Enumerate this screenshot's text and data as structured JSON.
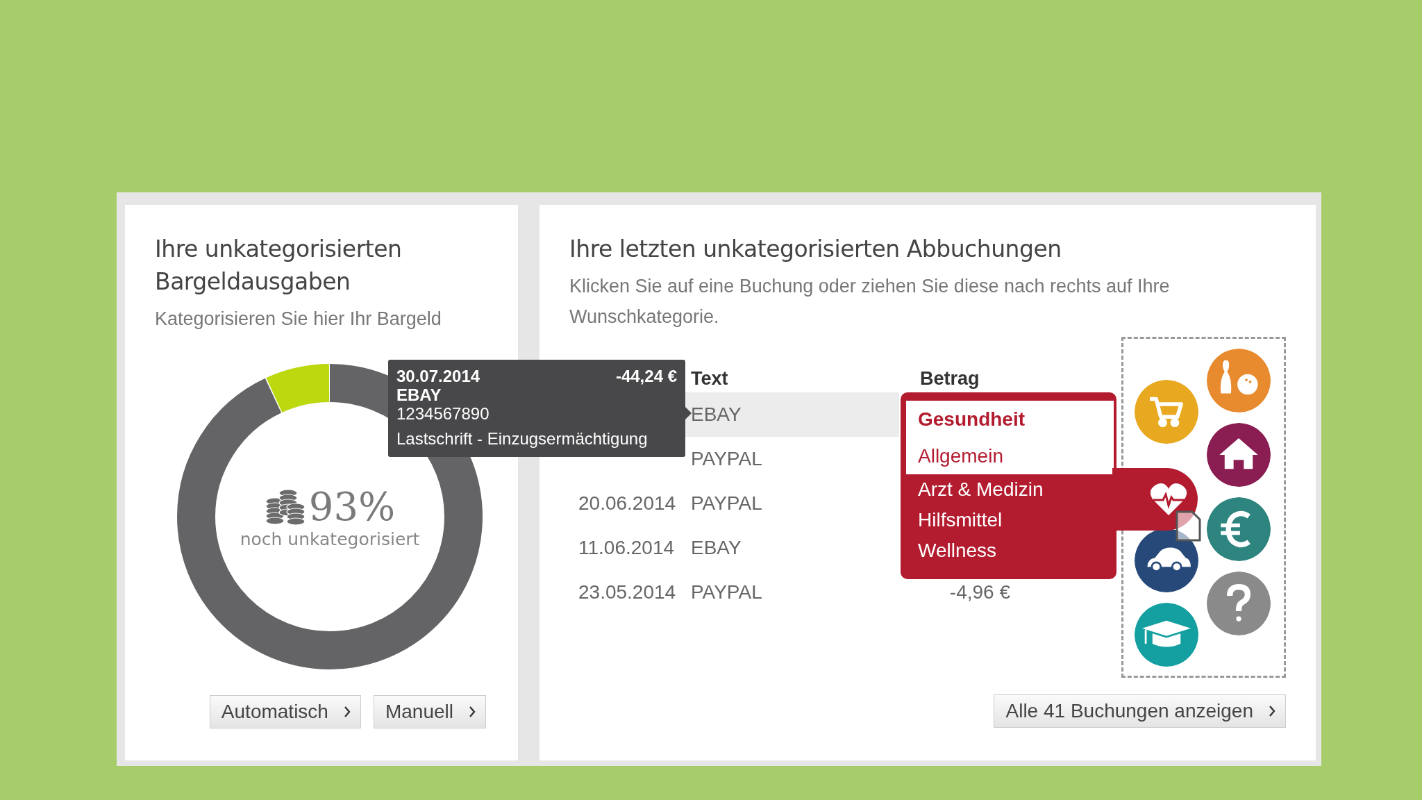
{
  "cash_card": {
    "title": "Ihre unkategorisierten Bargeldausgaben",
    "subtitle": "Kategorisieren Sie hier Ihr Bargeld",
    "donut": {
      "level": 0.93,
      "percent": "93%",
      "caption": "noch unkategorisiert"
    },
    "buttons": [
      "Automatisch",
      "Manuell"
    ]
  },
  "bookings_card": {
    "title": "Ihre letzten unkategorisierten Abbuchungen",
    "subtitle": "Klicken Sie auf eine Buchung oder ziehen Sie diese nach rechts auf Ihre Wunschkategorie.",
    "table": {
      "columns": [
        "Text",
        "Betrag"
      ],
      "rows": [
        {
          "text": "EBAY",
          "selected": true
        },
        {
          "text": "PAYPAL",
          "selected": false
        },
        {
          "date": "20.06.2014",
          "text": "PAYPAL",
          "selected": false
        },
        {
          "date": "11.06.2014",
          "text": "EBAY",
          "selected": false
        },
        {
          "date": "23.05.2014",
          "text": "PAYPAL",
          "amount": "-4,96 €",
          "selected": false
        }
      ]
    },
    "tooltip": {
      "date": "30.07.2014",
      "amount": "-44,24 €",
      "payee": "EBAY",
      "reference": "1234567890",
      "type": "Lastschrift - Einzugsermächtigung"
    },
    "category_menu": {
      "title": "Gesundheit",
      "items": [
        {
          "label": "Allgemein",
          "selected": true
        },
        {
          "label": "Arzt & Medizin",
          "selected": false
        },
        {
          "label": "Hilfsmittel",
          "selected": false
        },
        {
          "label": "Wellness",
          "selected": false
        }
      ]
    },
    "categories_left": [
      {
        "kind": "cart",
        "color": "#e8a820"
      },
      {
        "kind": "car",
        "color": "#27497a"
      },
      {
        "kind": "graduation",
        "color": "#14a0a0"
      }
    ],
    "categories_right": [
      {
        "kind": "bowling",
        "color": "#e88a2e"
      },
      {
        "kind": "house",
        "color": "#8a1e52"
      },
      {
        "kind": "euro",
        "color": "#2e8580"
      },
      {
        "kind": "question",
        "color": "#8a8a8a"
      }
    ],
    "button": "Alle 41 Buchungen anzeigen"
  }
}
